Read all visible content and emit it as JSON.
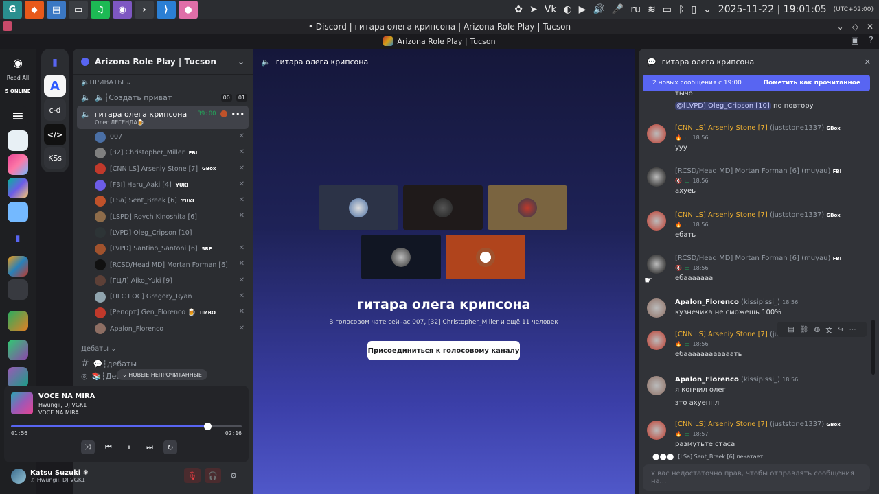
{
  "taskbar": {
    "lang": "ru",
    "clock": "2025-11-22 | 19:01:05",
    "tz": "(UTC+02:00)"
  },
  "window": {
    "title": "• Discord | гитара олега крипсона | Arizona Role Play | Tucson"
  },
  "discord_bar": {
    "server_title": "Arizona Role Play | Tucson"
  },
  "left_bar": {
    "read_all": "Read All",
    "online": "5 ONLINE"
  },
  "folder": {
    "items": [
      "c-d",
      "KSs"
    ]
  },
  "sidebar": {
    "server_name": "Arizona Role Play | Tucson",
    "category_private": "🔈ПРИВАТЫ",
    "create_private": "🔈┆Создать приват",
    "create_badge_a": "00",
    "create_badge_b": "01",
    "active_channel": "гитара олега крипсона",
    "active_timer": "39:00",
    "active_sub": "Олег ЛЕГЕНДА🍺",
    "users": [
      {
        "name": "007",
        "tag": "",
        "color": "#4a6fa5"
      },
      {
        "name": "[32] Christopher_Miller",
        "tag": "FBI",
        "color": "#7f7f7f"
      },
      {
        "name": "[CNN LS] Arseniy Stone [7]",
        "tag": "GBox",
        "color": "#c0392b"
      },
      {
        "name": "[FBI] Haru_Aaki [4]",
        "tag": "YUKI",
        "color": "#6c5ce7"
      },
      {
        "name": "[LSa] Sent_Breek [6]",
        "tag": "YUKI",
        "color": "#c0522a"
      },
      {
        "name": "[LSPD] Roych Kinoshita [6]",
        "tag": "",
        "color": "#8e6c4a"
      },
      {
        "name": "[LVPD] Oleg_Cripson [10]",
        "tag": "",
        "color": "#2d3436"
      },
      {
        "name": "[LVPD] Santino_Santoni [6]",
        "tag": "5RP",
        "color": "#a0522d"
      },
      {
        "name": "[RCSD/Head MD] Mortan Forman [6]",
        "tag": "",
        "color": "#111"
      },
      {
        "name": "[ГЦЛ] Aiko_Yuki [9]",
        "tag": "",
        "color": "#5d4037"
      },
      {
        "name": "[ПГС ГОС] Gregory_Ryan",
        "tag": "",
        "color": "#90a4ae"
      },
      {
        "name": "[Репорт] Gen_Florenco 🍺",
        "tag": "ПИВО",
        "color": "#c0392b"
      },
      {
        "name": "Apalon_Florenco",
        "tag": "",
        "color": "#8d6e63"
      }
    ],
    "category_debates": "Дебаты",
    "ch_debates1": "💬┆дебаты",
    "ch_debates2": "📚┆Дебаты",
    "unread_pill": "НОВЫЕ НЕПРОЧИТАННЫЕ"
  },
  "player": {
    "title": "VOCE NA MIRA",
    "artist": "Hwungii, DJ VGK1",
    "album": "VOCE NA MIRA",
    "elapsed": "01:56",
    "total": "02:16",
    "progress": 0.85
  },
  "user_panel": {
    "name": "Katsu Suzuki ❄",
    "status": "Hwungii, DJ VGK1"
  },
  "voice": {
    "channel": "гитара олега крипсона",
    "title": "гитара олега крипсона",
    "subtitle": "В голосовом чате сейчас 007, [32] Christopher_Miller и ещё 11 человек",
    "join_label": "Присоединиться к голосовому каналу"
  },
  "chat": {
    "channel": "гитара олега крипсона",
    "new_msgs": "2 новых сообщения с 19:00",
    "mark_read": "Пометить как прочитанное",
    "input_placeholder": "У вас недостаточно прав, чтобы отправлять сообщения на...",
    "typing": "[LSa] Sent_Breek [6] печатает...",
    "top_text": "тычо",
    "top_mention": "@[LVPD] Oleg_Cripson [10]",
    "top_rest": "по повтору",
    "messages": [
      {
        "org": "[CNN LS]",
        "name": "Arseniy Stone [7]",
        "handle": "(juststone1337)",
        "tag": "GBox",
        "time": "18:56",
        "text": "ууу",
        "av": "#c0392b",
        "style": "o"
      },
      {
        "org": "",
        "name": "[RCSD/Head MD] Mortan Forman [6]",
        "handle": "(muyau)",
        "tag": "FBI",
        "time": "18:56",
        "text": "ахуеь",
        "av": "#111",
        "style": "g"
      },
      {
        "org": "[CNN LS]",
        "name": "Arseniy Stone [7]",
        "handle": "(juststone1337)",
        "tag": "GBox",
        "time": "18:56",
        "text": "ебать",
        "av": "#c0392b",
        "style": "o"
      },
      {
        "org": "",
        "name": "[RCSD/Head MD] Mortan Forman [6]",
        "handle": "(muyau)",
        "tag": "FBI",
        "time": "18:56",
        "text": "ебааааааа",
        "av": "#111",
        "style": "g"
      },
      {
        "org": "",
        "name": "Apalon_Florenco",
        "handle": "(kissipissi_)",
        "tag": "",
        "time": "18:56",
        "text": "кузнечика не сможешь 100%",
        "av": "#8d6e63",
        "style": "w"
      },
      {
        "org": "[CNN LS]",
        "name": "Arseniy Stone [7]",
        "handle": "(ju",
        "tag": "",
        "time": "18:56",
        "text": "ебаааааааааааать",
        "av": "#c0392b",
        "style": "o"
      },
      {
        "org": "",
        "name": "Apalon_Florenco",
        "handle": "(kissipissi_)",
        "tag": "",
        "time": "18:56",
        "text": "я кончил олег",
        "text2": "это ахуеннл",
        "av": "#8d6e63",
        "style": "w"
      },
      {
        "org": "[CNN LS]",
        "name": "Arseniy Stone [7]",
        "handle": "(juststone1337)",
        "tag": "GBox",
        "time": "18:57",
        "text": "размутьте стаса",
        "av": "#c0392b",
        "style": "o"
      }
    ]
  }
}
